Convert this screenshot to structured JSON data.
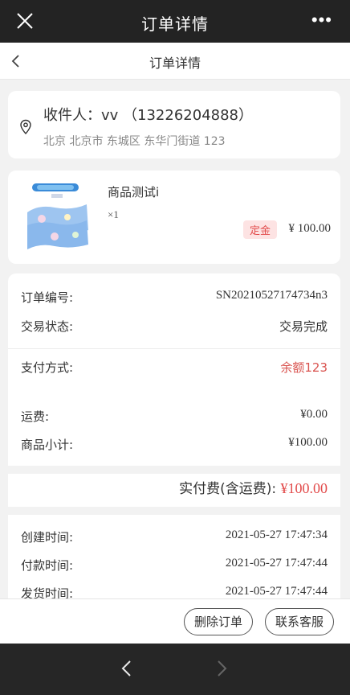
{
  "topbar": {
    "title": "订单详情",
    "more": "•••",
    "close_icon": "close-icon"
  },
  "navbar": {
    "title": "订单详情",
    "back_icon": "chevron-left-icon"
  },
  "address": {
    "recipient": "收件人：vv （13226204888）",
    "detail": "北京 北京市 东城区 东华门街道 123",
    "icon": "location-pin-icon"
  },
  "goods": {
    "name": "商品测试i",
    "qty": "×1",
    "tag": "定金",
    "price": "¥ 100.00"
  },
  "order": {
    "no_label": "订单编号:",
    "no_value": "SN20210527174734n3",
    "status_label": "交易状态:",
    "status_value": "交易完成",
    "pay_label": "支付方式:",
    "pay_value": "余额123",
    "freight_label": "运费:",
    "freight_value": "¥0.00",
    "subtotal_label": "商品小计:",
    "subtotal_value": "¥100.00",
    "total_label": "实付费(含运费):",
    "total_value": "¥100.00",
    "created_label": "创建时间:",
    "created_value": "2021-05-27 17:47:34",
    "paid_label": "付款时间:",
    "paid_value": "2021-05-27 17:47:44",
    "shipped_label": "发货时间:",
    "shipped_value": "2021-05-27 17:47:44"
  },
  "actions": {
    "delete": "删除订单",
    "service": "联系客服"
  },
  "colors": {
    "accent_red": "#e24b4b",
    "topbar_bg": "#232323"
  }
}
